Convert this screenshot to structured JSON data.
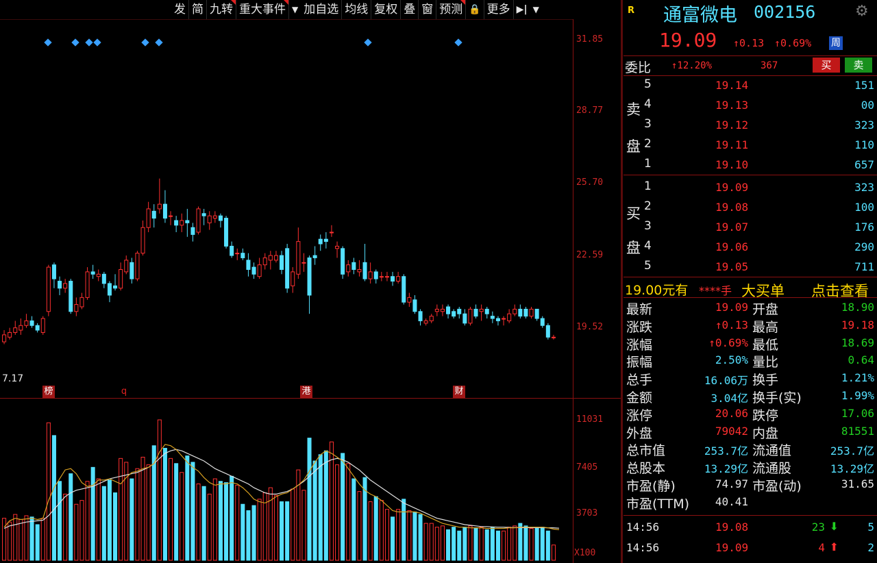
{
  "toolbar": {
    "items": [
      "发",
      "简",
      "九转",
      "重大事件",
      "加自选",
      "均线",
      "复权",
      "叠",
      "窗",
      "预测",
      "更多"
    ],
    "lock_glyph": "🔒",
    "dropdown_glyph": "▼",
    "exit_glyph": "▶|"
  },
  "price_axis": [
    "31.85",
    "28.77",
    "25.70",
    "22.59",
    "19.52"
  ],
  "volume_axis": [
    "11031",
    "7405",
    "3703",
    "X100"
  ],
  "chart_extras": {
    "low_marker": "7.17",
    "events": [
      "榜",
      "q",
      "港",
      "财"
    ]
  },
  "colors": {
    "up": "#ff3030",
    "down": "#55e0ff",
    "ma_yellow": "#d8a020",
    "ma_white": "#e0e0e0",
    "separator": "#8a1010"
  },
  "chart_data": {
    "type": "candlestick",
    "ylim_price": [
      17.17,
      31.85
    ],
    "ylim_volume": [
      0,
      11031
    ],
    "candles": [
      {
        "o": 18.9,
        "c": 19.2,
        "h": 19.4,
        "l": 18.8,
        "v": 3300
      },
      {
        "o": 19.1,
        "c": 19.3,
        "h": 19.5,
        "l": 19.0,
        "v": 3000
      },
      {
        "o": 19.3,
        "c": 19.5,
        "h": 19.8,
        "l": 19.2,
        "v": 3600
      },
      {
        "o": 19.4,
        "c": 19.6,
        "h": 19.9,
        "l": 19.2,
        "v": 3200
      },
      {
        "o": 19.6,
        "c": 19.8,
        "h": 20.1,
        "l": 19.5,
        "v": 3500
      },
      {
        "o": 19.8,
        "c": 19.6,
        "h": 20.0,
        "l": 19.5,
        "v": 3400
      },
      {
        "o": 19.6,
        "c": 19.4,
        "h": 19.7,
        "l": 19.3,
        "v": 2800
      },
      {
        "o": 19.3,
        "c": 19.9,
        "h": 20.0,
        "l": 19.2,
        "v": 3300
      },
      {
        "o": 20.2,
        "c": 22.1,
        "h": 22.2,
        "l": 20.0,
        "v": 10800
      },
      {
        "o": 22.2,
        "c": 21.6,
        "h": 22.3,
        "l": 21.2,
        "v": 9800
      },
      {
        "o": 21.5,
        "c": 21.2,
        "h": 21.7,
        "l": 20.9,
        "v": 6200
      },
      {
        "o": 21.2,
        "c": 21.4,
        "h": 21.6,
        "l": 21.0,
        "v": 5200
      },
      {
        "o": 21.5,
        "c": 20.2,
        "h": 21.6,
        "l": 20.1,
        "v": 6800
      },
      {
        "o": 20.2,
        "c": 20.5,
        "h": 20.8,
        "l": 20.0,
        "v": 4400
      },
      {
        "o": 20.4,
        "c": 20.8,
        "h": 21.0,
        "l": 20.3,
        "v": 4700
      },
      {
        "o": 20.8,
        "c": 21.9,
        "h": 22.1,
        "l": 20.7,
        "v": 6200
      },
      {
        "o": 21.9,
        "c": 21.8,
        "h": 22.2,
        "l": 21.6,
        "v": 7300
      },
      {
        "o": 21.7,
        "c": 21.8,
        "h": 22.0,
        "l": 21.5,
        "v": 6400
      },
      {
        "o": 21.8,
        "c": 21.4,
        "h": 21.9,
        "l": 21.2,
        "v": 5800
      },
      {
        "o": 21.4,
        "c": 20.9,
        "h": 21.5,
        "l": 20.6,
        "v": 6300
      },
      {
        "o": 21.3,
        "c": 21.2,
        "h": 21.8,
        "l": 21.1,
        "v": 5300
      },
      {
        "o": 21.2,
        "c": 22.0,
        "h": 22.3,
        "l": 21.1,
        "v": 8000
      },
      {
        "o": 21.9,
        "c": 22.4,
        "h": 22.6,
        "l": 21.8,
        "v": 7700
      },
      {
        "o": 22.3,
        "c": 21.6,
        "h": 22.5,
        "l": 21.4,
        "v": 6400
      },
      {
        "o": 21.6,
        "c": 22.7,
        "h": 22.8,
        "l": 21.5,
        "v": 7200
      },
      {
        "o": 22.7,
        "c": 23.8,
        "h": 24.1,
        "l": 22.6,
        "v": 8100
      },
      {
        "o": 23.8,
        "c": 24.6,
        "h": 24.9,
        "l": 23.6,
        "v": 7500
      },
      {
        "o": 24.5,
        "c": 24.2,
        "h": 24.8,
        "l": 23.8,
        "v": 9000
      },
      {
        "o": 24.6,
        "c": 24.8,
        "h": 25.9,
        "l": 24.4,
        "v": 11031
      },
      {
        "o": 24.8,
        "c": 24.2,
        "h": 25.4,
        "l": 24.0,
        "v": 8800
      },
      {
        "o": 24.3,
        "c": 24.3,
        "h": 24.5,
        "l": 23.9,
        "v": 8000
      },
      {
        "o": 24.1,
        "c": 23.9,
        "h": 24.3,
        "l": 23.6,
        "v": 7600
      },
      {
        "o": 23.9,
        "c": 24.1,
        "h": 24.4,
        "l": 23.6,
        "v": 6900
      },
      {
        "o": 24.1,
        "c": 24.0,
        "h": 24.6,
        "l": 23.4,
        "v": 8200
      },
      {
        "o": 23.8,
        "c": 23.5,
        "h": 24.0,
        "l": 23.2,
        "v": 7700
      },
      {
        "o": 23.6,
        "c": 24.6,
        "h": 24.7,
        "l": 23.5,
        "v": 6000
      },
      {
        "o": 24.4,
        "c": 24.3,
        "h": 24.6,
        "l": 23.9,
        "v": 5800
      },
      {
        "o": 24.0,
        "c": 24.3,
        "h": 24.5,
        "l": 23.7,
        "v": 5200
      },
      {
        "o": 24.2,
        "c": 24.3,
        "h": 24.5,
        "l": 24.0,
        "v": 6400
      },
      {
        "o": 24.3,
        "c": 24.1,
        "h": 24.4,
        "l": 23.8,
        "v": 6200
      },
      {
        "o": 24.2,
        "c": 23.0,
        "h": 24.3,
        "l": 22.9,
        "v": 6100
      },
      {
        "o": 23.0,
        "c": 22.6,
        "h": 23.2,
        "l": 22.5,
        "v": 6600
      },
      {
        "o": 22.7,
        "c": 22.7,
        "h": 22.9,
        "l": 22.4,
        "v": 5900
      },
      {
        "o": 22.7,
        "c": 22.5,
        "h": 22.9,
        "l": 22.4,
        "v": 4400
      },
      {
        "o": 22.4,
        "c": 22.0,
        "h": 22.7,
        "l": 21.7,
        "v": 3900
      },
      {
        "o": 22.1,
        "c": 21.8,
        "h": 22.3,
        "l": 21.6,
        "v": 4300
      },
      {
        "o": 21.7,
        "c": 22.2,
        "h": 22.5,
        "l": 21.6,
        "v": 4800
      },
      {
        "o": 22.2,
        "c": 22.5,
        "h": 22.7,
        "l": 22.0,
        "v": 5300
      },
      {
        "o": 22.4,
        "c": 22.6,
        "h": 22.8,
        "l": 22.0,
        "v": 5700
      },
      {
        "o": 22.4,
        "c": 22.6,
        "h": 22.8,
        "l": 22.3,
        "v": 5100
      },
      {
        "o": 22.6,
        "c": 22.0,
        "h": 22.8,
        "l": 21.8,
        "v": 4600
      },
      {
        "o": 22.9,
        "c": 21.2,
        "h": 23.1,
        "l": 21.0,
        "v": 4600
      },
      {
        "o": 21.3,
        "c": 21.9,
        "h": 22.1,
        "l": 21.0,
        "v": 5600
      },
      {
        "o": 21.8,
        "c": 23.2,
        "h": 23.8,
        "l": 21.6,
        "v": 7100
      },
      {
        "o": 22.3,
        "c": 22.3,
        "h": 22.7,
        "l": 21.9,
        "v": 5500
      },
      {
        "o": 22.5,
        "c": 20.9,
        "h": 22.6,
        "l": 20.1,
        "v": 9600
      },
      {
        "o": 22.6,
        "c": 22.5,
        "h": 23.0,
        "l": 22.2,
        "v": 7800
      },
      {
        "o": 23.3,
        "c": 23.1,
        "h": 23.5,
        "l": 22.8,
        "v": 8300
      },
      {
        "o": 23.3,
        "c": 23.2,
        "h": 23.6,
        "l": 22.9,
        "v": 8600
      },
      {
        "o": 23.6,
        "c": 23.6,
        "h": 23.9,
        "l": 23.4,
        "v": 9300
      },
      {
        "o": 22.9,
        "c": 23.0,
        "h": 23.2,
        "l": 22.5,
        "v": 7500
      },
      {
        "o": 22.9,
        "c": 21.8,
        "h": 23.0,
        "l": 21.6,
        "v": 8400
      },
      {
        "o": 21.9,
        "c": 22.2,
        "h": 22.4,
        "l": 21.7,
        "v": 7600
      },
      {
        "o": 22.3,
        "c": 22.0,
        "h": 22.5,
        "l": 21.8,
        "v": 6400
      },
      {
        "o": 21.9,
        "c": 22.0,
        "h": 22.4,
        "l": 21.7,
        "v": 5400
      },
      {
        "o": 22.3,
        "c": 21.6,
        "h": 23.1,
        "l": 21.5,
        "v": 6500
      },
      {
        "o": 21.6,
        "c": 21.9,
        "h": 22.3,
        "l": 21.4,
        "v": 4600
      },
      {
        "o": 21.9,
        "c": 21.6,
        "h": 22.0,
        "l": 21.4,
        "v": 5000
      },
      {
        "o": 21.7,
        "c": 21.7,
        "h": 21.9,
        "l": 21.5,
        "v": 4700
      },
      {
        "o": 21.7,
        "c": 21.7,
        "h": 21.9,
        "l": 21.5,
        "v": 4000
      },
      {
        "o": 21.7,
        "c": 21.5,
        "h": 21.9,
        "l": 21.3,
        "v": 3400
      },
      {
        "o": 21.5,
        "c": 21.7,
        "h": 21.9,
        "l": 21.4,
        "v": 4000
      },
      {
        "o": 21.7,
        "c": 20.6,
        "h": 21.8,
        "l": 20.5,
        "v": 4800
      },
      {
        "o": 20.6,
        "c": 20.8,
        "h": 21.0,
        "l": 20.4,
        "v": 3900
      },
      {
        "o": 20.7,
        "c": 20.2,
        "h": 20.9,
        "l": 20.1,
        "v": 3800
      },
      {
        "o": 20.2,
        "c": 19.8,
        "h": 20.3,
        "l": 19.6,
        "v": 3600
      },
      {
        "o": 19.7,
        "c": 19.8,
        "h": 19.9,
        "l": 19.6,
        "v": 2900
      },
      {
        "o": 19.8,
        "c": 20.0,
        "h": 20.1,
        "l": 19.7,
        "v": 2900
      },
      {
        "o": 20.2,
        "c": 20.3,
        "h": 20.5,
        "l": 20.0,
        "v": 2600
      },
      {
        "o": 20.2,
        "c": 20.3,
        "h": 20.5,
        "l": 20.0,
        "v": 2700
      },
      {
        "o": 20.4,
        "c": 20.1,
        "h": 20.5,
        "l": 19.9,
        "v": 2400
      },
      {
        "o": 20.2,
        "c": 20.0,
        "h": 20.3,
        "l": 19.9,
        "v": 2600
      },
      {
        "o": 20.3,
        "c": 20.1,
        "h": 20.4,
        "l": 19.9,
        "v": 2300
      },
      {
        "o": 20.1,
        "c": 19.7,
        "h": 20.3,
        "l": 19.6,
        "v": 2600
      },
      {
        "o": 19.7,
        "c": 20.3,
        "h": 20.4,
        "l": 19.6,
        "v": 2700
      },
      {
        "o": 20.3,
        "c": 20.0,
        "h": 20.5,
        "l": 19.9,
        "v": 2500
      },
      {
        "o": 20.2,
        "c": 20.3,
        "h": 20.5,
        "l": 19.8,
        "v": 2600
      },
      {
        "o": 20.3,
        "c": 20.1,
        "h": 20.4,
        "l": 19.9,
        "v": 2400
      },
      {
        "o": 20.0,
        "c": 19.9,
        "h": 20.2,
        "l": 19.7,
        "v": 2600
      },
      {
        "o": 19.9,
        "c": 19.8,
        "h": 20.0,
        "l": 19.6,
        "v": 2300
      },
      {
        "o": 19.9,
        "c": 19.9,
        "h": 20.0,
        "l": 19.6,
        "v": 2300
      },
      {
        "o": 19.8,
        "c": 20.1,
        "h": 20.3,
        "l": 19.7,
        "v": 2600
      },
      {
        "o": 20.1,
        "c": 20.3,
        "h": 20.5,
        "l": 20.0,
        "v": 2700
      },
      {
        "o": 20.3,
        "c": 20.0,
        "h": 20.5,
        "l": 19.9,
        "v": 2900
      },
      {
        "o": 20.3,
        "c": 20.0,
        "h": 20.4,
        "l": 19.9,
        "v": 2700
      },
      {
        "o": 20.0,
        "c": 20.3,
        "h": 20.4,
        "l": 19.9,
        "v": 2500
      },
      {
        "o": 20.3,
        "c": 19.9,
        "h": 20.3,
        "l": 19.8,
        "v": 2500
      },
      {
        "o": 19.9,
        "c": 19.6,
        "h": 20.0,
        "l": 19.5,
        "v": 2600
      },
      {
        "o": 19.6,
        "c": 19.1,
        "h": 19.7,
        "l": 19.0,
        "v": 2300
      },
      {
        "o": 19.1,
        "c": 19.1,
        "h": 19.2,
        "l": 19.0,
        "v": 1200
      }
    ],
    "ma_yellow": [
      2600,
      3100,
      3300,
      3200,
      3250,
      3300,
      3200,
      3300,
      4700,
      5700,
      6400,
      7100,
      7200,
      6800,
      6100,
      5800,
      5900,
      6300,
      6300,
      6400,
      6200,
      6000,
      6500,
      6900,
      7000,
      7200,
      7300,
      7600,
      8500,
      9100,
      9000,
      8700,
      8200,
      7700,
      7300,
      7000,
      6500,
      6100,
      5900,
      6000,
      6000,
      6100,
      6000,
      5700,
      5300,
      4800,
      4600,
      4500,
      4700,
      5000,
      5200,
      5300,
      5600,
      5900,
      6300,
      7000,
      7700,
      8300,
      8600,
      8400,
      8100,
      7800,
      7200,
      6600,
      6000,
      5500,
      5200,
      5000,
      4700,
      4300,
      3900,
      3800,
      3800,
      3800,
      3800,
      3700,
      3500,
      3300,
      3100,
      2900,
      2800,
      2700,
      2600,
      2600,
      2550,
      2550,
      2550,
      2500,
      2500,
      2500,
      2500,
      2550,
      2550,
      2600,
      2600,
      2600,
      2600,
      2600,
      2550,
      2450,
      2400
    ],
    "ma_white": [
      2500,
      2700,
      2800,
      2900,
      3000,
      3050,
      3100,
      3150,
      3500,
      4000,
      4500,
      5000,
      5300,
      5500,
      5600,
      5700,
      5800,
      6000,
      6200,
      6400,
      6500,
      6600,
      6700,
      6800,
      6900,
      7100,
      7300,
      7600,
      8000,
      8400,
      8600,
      8700,
      8600,
      8400,
      8200,
      8000,
      7800,
      7500,
      7200,
      7000,
      6800,
      6600,
      6400,
      6200,
      6000,
      5700,
      5500,
      5300,
      5200,
      5200,
      5300,
      5400,
      5600,
      5900,
      6200,
      6600,
      7000,
      7400,
      7700,
      7900,
      8000,
      7900,
      7700,
      7400,
      7100,
      6700,
      6300,
      6000,
      5700,
      5400,
      5100,
      4800,
      4500,
      4300,
      4100,
      3900,
      3700,
      3500,
      3300,
      3200,
      3100,
      3000,
      2900,
      2800,
      2750,
      2700,
      2650,
      2650,
      2620,
      2600,
      2600,
      2580,
      2570,
      2560,
      2560,
      2560,
      2560,
      2560,
      2550,
      2550,
      2520
    ]
  },
  "quote": {
    "r_badge": "R",
    "name": "通富微电",
    "code": "002156",
    "price": "19.09",
    "change": "↑0.13",
    "change_pct": "↑0.69%",
    "week_badge": "周",
    "weibi_label": "委比",
    "weibi_value": "↑12.20%",
    "weicha_value": "367",
    "buy_btn": "买",
    "sell_btn": "卖",
    "sell_label_1": "卖",
    "sell_label_2": "盘",
    "buy_label_1": "买",
    "buy_label_2": "盘",
    "asks": [
      {
        "level": "5",
        "price": "19.14",
        "vol": "151"
      },
      {
        "level": "4",
        "price": "19.13",
        "vol": "00"
      },
      {
        "level": "3",
        "price": "19.12",
        "vol": "323"
      },
      {
        "level": "2",
        "price": "19.11",
        "vol": "110"
      },
      {
        "level": "1",
        "price": "19.10",
        "vol": "657"
      }
    ],
    "bids": [
      {
        "level": "1",
        "price": "19.09",
        "vol": "323"
      },
      {
        "level": "2",
        "price": "19.08",
        "vol": "100"
      },
      {
        "level": "3",
        "price": "19.07",
        "vol": "176"
      },
      {
        "level": "4",
        "price": "19.06",
        "vol": "290"
      },
      {
        "level": "5",
        "price": "19.05",
        "vol": "711"
      }
    ],
    "bigorder_a": "19.00元有",
    "bigorder_b": "****手",
    "bigorder_c": "大买单",
    "bigorder_d": "点击查看",
    "stats": [
      {
        "l1": "最新",
        "v1": "19.09",
        "c1": "red",
        "l2": "开盘",
        "v2": "18.90",
        "c2": "green"
      },
      {
        "l1": "涨跌",
        "v1": "↑0.13",
        "c1": "red",
        "l2": "最高",
        "v2": "19.18",
        "c2": "red"
      },
      {
        "l1": "涨幅",
        "v1": "↑0.69%",
        "c1": "red",
        "l2": "最低",
        "v2": "18.69",
        "c2": "green"
      },
      {
        "l1": "振幅",
        "v1": "2.50%",
        "c1": "cyan",
        "l2": "量比",
        "v2": "0.64",
        "c2": "green"
      },
      {
        "l1": "总手",
        "v1": "16.06万",
        "c1": "cyan",
        "l2": "换手",
        "v2": "1.21%",
        "c2": "cyan"
      },
      {
        "l1": "金额",
        "v1": "3.04亿",
        "c1": "cyan",
        "l2": "换手(实)",
        "v2": "1.99%",
        "c2": "cyan"
      },
      {
        "l1": "涨停",
        "v1": "20.06",
        "c1": "red",
        "l2": "跌停",
        "v2": "17.06",
        "c2": "green"
      },
      {
        "l1": "外盘",
        "v1": "79042",
        "c1": "red",
        "l2": "内盘",
        "v2": "81551",
        "c2": "green"
      },
      {
        "l1": "总市值",
        "v1": "253.7亿",
        "c1": "cyan",
        "l2": "流通值",
        "v2": "253.7亿",
        "c2": "cyan"
      },
      {
        "l1": "总股本",
        "v1": "13.29亿",
        "c1": "cyan",
        "l2": "流通股",
        "v2": "13.29亿",
        "c2": "cyan"
      },
      {
        "l1": "市盈(静)",
        "v1": "74.97",
        "c1": "white",
        "l2": "市盈(动)",
        "v2": "31.65",
        "c2": "white"
      },
      {
        "l1": "市盈(TTM)",
        "v1": "40.41",
        "c1": "white",
        "l2": "",
        "v2": "",
        "c2": "white"
      }
    ],
    "ticks": [
      {
        "time": "14:56",
        "price": "19.08",
        "vol": "23",
        "dir": "down",
        "count": "5"
      },
      {
        "time": "14:56",
        "price": "19.09",
        "vol": "4",
        "dir": "up",
        "count": "2"
      }
    ]
  }
}
